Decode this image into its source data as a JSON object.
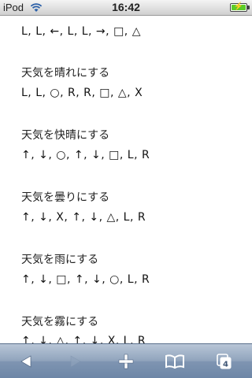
{
  "status_bar": {
    "carrier": "iPod",
    "time": "16:42",
    "wifi_icon": "wifi-icon",
    "battery_icon": "battery-charging-icon"
  },
  "content": {
    "top_sequence": "L, L, ←, L, L, →, □, △",
    "sections": [
      {
        "title": "天気を晴れにする",
        "sequence": "L, L, ○, R, R, □, △, X"
      },
      {
        "title": "天気を快晴にする",
        "sequence": "↑, ↓, ○, ↑, ↓, □, L, R"
      },
      {
        "title": "天気を曇りにする",
        "sequence": "↑, ↓, X, ↑, ↓, △, L, R"
      },
      {
        "title": "天気を雨にする",
        "sequence": "↑, ↓, □, ↑, ↓, ○, L, R"
      },
      {
        "title": "天気を霧にする",
        "sequence": "↑, ↓, △, ↑, ↓, X, L, R"
      }
    ]
  },
  "toolbar": {
    "back_icon": "back-arrow-icon",
    "forward_icon": "forward-arrow-icon",
    "add_icon": "plus-icon",
    "bookmarks_icon": "bookmarks-book-icon",
    "pages_icon": "pages-icon",
    "pages_count": "4"
  },
  "colors": {
    "toolbar_top": "#b9c6d7",
    "toolbar_bottom": "#6d86a6",
    "battery_green": "#5ccc2a"
  }
}
